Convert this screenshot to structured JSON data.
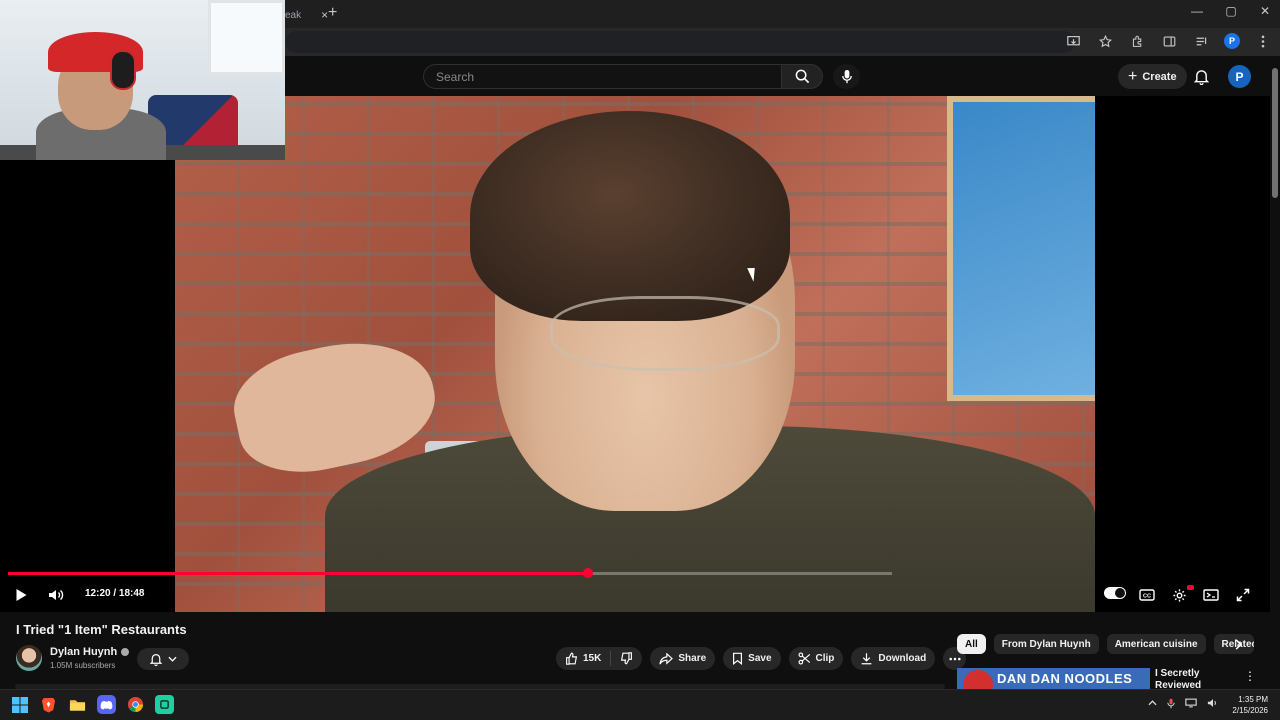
{
  "browser": {
    "tab_title": "eak",
    "tab_close": "×",
    "new_tab": "+",
    "window_controls": [
      "—",
      "▢",
      "✕"
    ],
    "profile_initial": "P"
  },
  "header": {
    "search_placeholder": "Search",
    "create_label": "Create",
    "avatar_initial": "P"
  },
  "player": {
    "time_current": "12:20",
    "time_total": "18:48",
    "time_display": "12:20 / 18:48",
    "progress_fraction": 0.656
  },
  "video": {
    "title": "I Tried \"1 Item\" Restaurants",
    "channel_name": "Dylan Huynh",
    "subscribers": "1.05M subscribers"
  },
  "actions": {
    "like_count": "15K",
    "share": "Share",
    "save": "Save",
    "clip": "Clip",
    "download": "Download"
  },
  "chips": [
    "All",
    "From Dylan Huynh",
    "American cuisine",
    "Relatec"
  ],
  "recommendation": {
    "thumb_text": "DAN DAN NOODLES",
    "title": "I Secretly Reviewed Restaurants Askin"
  },
  "taskbar": {
    "time": "1:35 PM",
    "date": "2/15/2026"
  },
  "colors": {
    "accent_red": "#ff0033",
    "background": "#0f0f0f",
    "pill": "#272727"
  }
}
